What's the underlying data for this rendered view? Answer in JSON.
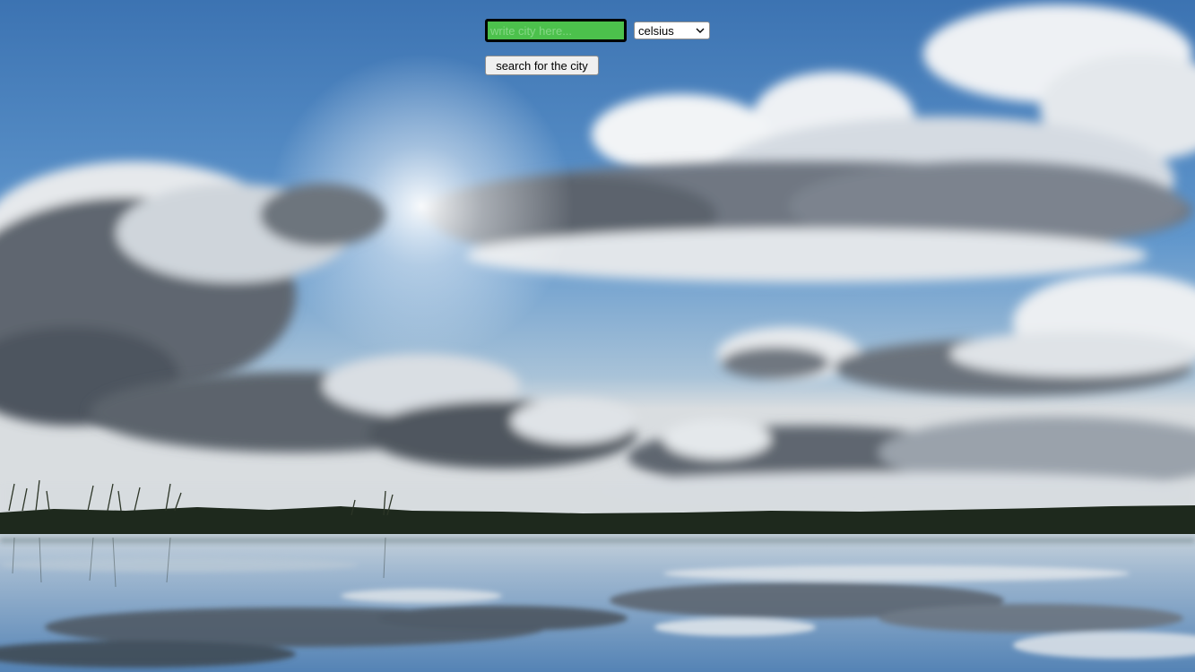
{
  "search": {
    "placeholder": "write city here...",
    "value": "",
    "button_label": "search for the city"
  },
  "units": {
    "selected": "celsius",
    "icon": "chevron-down-icon"
  },
  "background": {
    "sky_top": "#3f78b8",
    "sky_mid": "#6a9fd0",
    "horizon": "#c9d6df",
    "treeline": "#1f2a1e",
    "water_top": "#c3d0db",
    "water_bottom": "#5d89b8"
  },
  "colors": {
    "input_bg": "#4cc14c",
    "input_border": "#000000"
  }
}
